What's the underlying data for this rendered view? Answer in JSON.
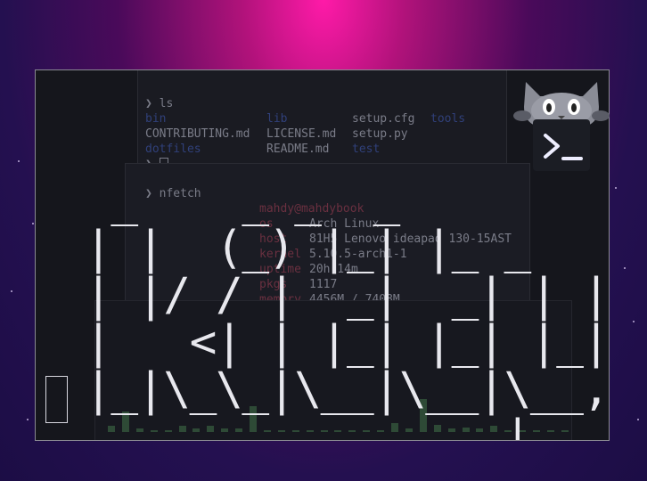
{
  "ls_pane": {
    "prompt_glyph": "❯",
    "command": "ls",
    "row1": [
      "bin",
      "lib",
      "setup.cfg",
      "tools"
    ],
    "row2": [
      "CONTRIBUTING.md",
      "LICENSE.md",
      "setup.py"
    ],
    "row3": [
      "dotfiles",
      "README.md",
      "test"
    ],
    "cursor_prompt": "❯"
  },
  "neofetch_pane": {
    "command": "❯ nfetch",
    "user_host": "mahdy@mahdybook",
    "fields": [
      {
        "key": "os",
        "value": "Arch Linux"
      },
      {
        "key": "host",
        "value": "81H5 Lenovo ideapad 130-15AST"
      },
      {
        "key": "kernel",
        "value": "5.10.5-arch1-1"
      },
      {
        "key": "uptime",
        "value": "20h 14m"
      },
      {
        "key": "pkgs",
        "value": "1117"
      },
      {
        "key": "memory",
        "value": "4456M / 7408M"
      }
    ]
  },
  "cava_pane": {
    "levels": [
      0.12,
      0.38,
      0.06,
      0.02,
      0.04,
      0.12,
      0.06,
      0.12,
      0.06,
      0.06,
      0.48,
      0.04,
      0.02,
      0.02,
      0.02,
      0.02,
      0.02,
      0.02,
      0.02,
      0.02,
      0.16,
      0.06,
      0.62,
      0.14,
      0.06,
      0.08,
      0.06,
      0.12,
      0.02,
      0.02,
      0.02,
      0.04,
      0.04
    ]
  },
  "logo": {
    "ascii": " _    _ _  _\n| |  (_) |_| |_ _   _\n| |/ / |  _|  _| | | |\n|   <| | |_| |_| |_| |\n|_|\\_\\_|\\__|\\__|\\__, |\n                |___/"
  },
  "colors": {
    "accent": "#ff1aa8",
    "background": "#1c0d45",
    "terminal_bg": "#15161c",
    "text": "#e8e8ee",
    "visualizer_bar": "#2e4a36"
  },
  "icons": {
    "app_icon": "kitty-cat-terminal-icon"
  }
}
